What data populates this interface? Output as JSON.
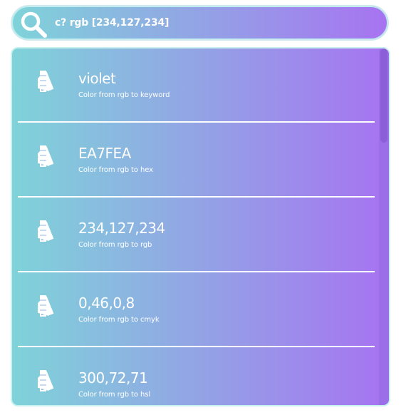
{
  "search": {
    "query": "c? rgb [234,127,234]",
    "icon": "search-icon"
  },
  "results": [
    {
      "title": "violet",
      "subtitle": "Color from rgb to keyword",
      "icon": "color-swatch-icon"
    },
    {
      "title": "EA7FEA",
      "subtitle": "Color from rgb to hex",
      "icon": "color-swatch-icon"
    },
    {
      "title": "234,127,234",
      "subtitle": "Color from rgb to rgb",
      "icon": "color-swatch-icon"
    },
    {
      "title": "0,46,0,8",
      "subtitle": "Color from rgb to cmyk",
      "icon": "color-swatch-icon"
    },
    {
      "title": "300,72,71",
      "subtitle": "Color from rgb to hsl",
      "icon": "color-swatch-icon"
    }
  ],
  "colors": {
    "gradient_start": "#7fd3d9",
    "gradient_end": "#a773f1",
    "text": "#ffffff"
  }
}
